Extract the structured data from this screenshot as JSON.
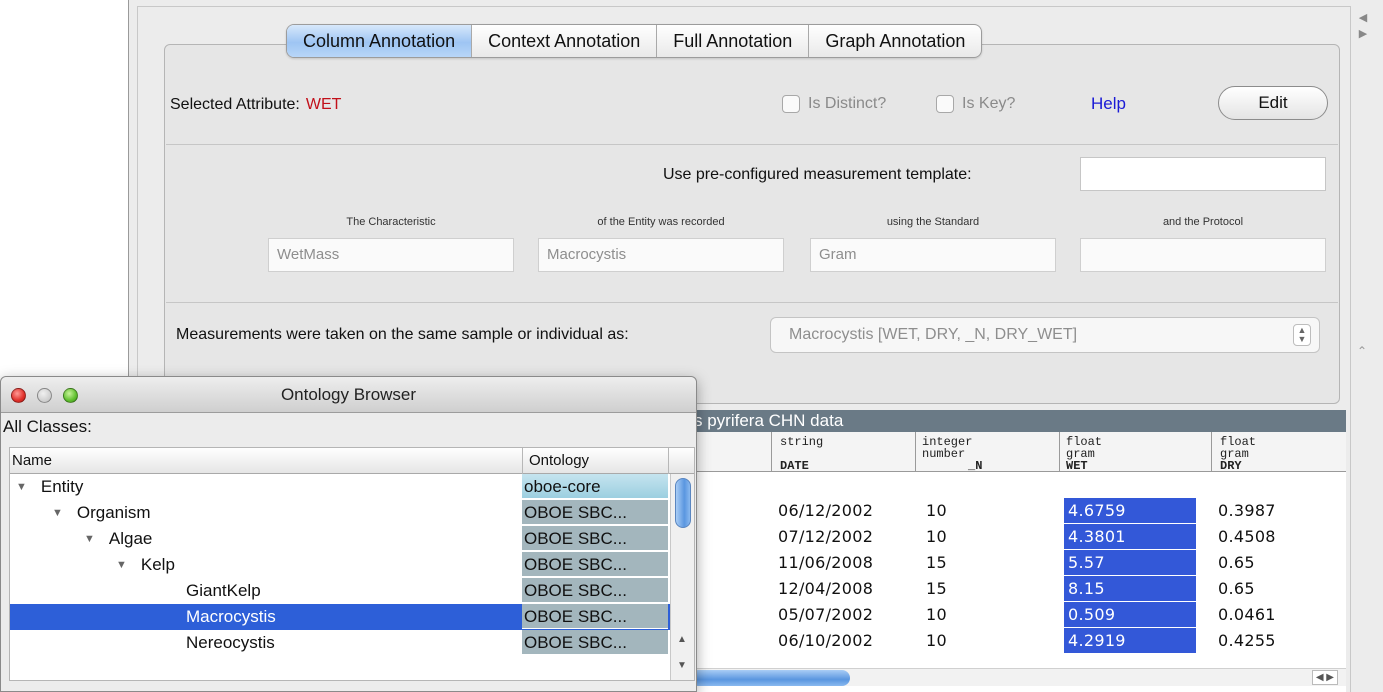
{
  "tabs": [
    "Column Annotation",
    "Context Annotation",
    "Full Annotation",
    "Graph Annotation"
  ],
  "active_tab": 0,
  "attribute": {
    "label": "Selected Attribute:",
    "value": "WET",
    "is_distinct_label": "Is Distinct?",
    "is_key_label": "Is Key?",
    "help_label": "Help",
    "edit_label": "Edit"
  },
  "template": {
    "label": "Use pre-configured measurement template:",
    "value": ""
  },
  "columns": [
    {
      "caption": "The Characteristic",
      "value": "WetMass"
    },
    {
      "caption": "of the Entity was recorded",
      "value": "Macrocystis"
    },
    {
      "caption": "using the Standard",
      "value": "Gram"
    },
    {
      "caption": "and the Protocol",
      "value": ""
    }
  ],
  "measurements": {
    "label": "Measurements were taken on the same sample or individual as:",
    "selected": "Macrocystis [WET, DRY, _N, DRY_WET]"
  },
  "data_table": {
    "title": "s pyrifera CHN data",
    "headers": [
      {
        "type": "",
        "unit": "",
        "name": ""
      },
      {
        "type": "string",
        "unit": "",
        "name": "DATE"
      },
      {
        "type": "integer",
        "unit": "number",
        "name": "_N"
      },
      {
        "type": "float",
        "unit": "gram",
        "name": "WET"
      },
      {
        "type": "float",
        "unit": "gram",
        "name": "DRY"
      }
    ],
    "rows": [
      [
        "06/12/2002",
        "10",
        "4.6759",
        "0.3987"
      ],
      [
        "07/12/2002",
        "10",
        "4.3801",
        "0.4508"
      ],
      [
        "11/06/2008",
        "15",
        "5.57",
        "0.65"
      ],
      [
        "12/04/2008",
        "15",
        "8.15",
        "0.65"
      ],
      [
        "05/07/2002",
        "10",
        "0.509",
        "0.0461"
      ],
      [
        "06/10/2002",
        "10",
        "4.2919",
        "0.4255"
      ]
    ]
  },
  "ontology_browser": {
    "title": "Ontology Browser",
    "subtitle": "All Classes:",
    "col_name": "Name",
    "col_ontology": "Ontology",
    "rows": [
      {
        "name": "Entity",
        "level": 0,
        "expanded": true,
        "ontology": "oboe-core"
      },
      {
        "name": "Organism",
        "level": 1,
        "expanded": true,
        "ontology": "OBOE SBC..."
      },
      {
        "name": "Algae",
        "level": 2,
        "expanded": true,
        "ontology": "OBOE SBC..."
      },
      {
        "name": "Kelp",
        "level": 3,
        "expanded": true,
        "ontology": "OBOE SBC..."
      },
      {
        "name": "GiantKelp",
        "level": 4,
        "expanded": false,
        "ontology": "OBOE SBC..."
      },
      {
        "name": "Macrocystis",
        "level": 4,
        "expanded": false,
        "ontology": "OBOE SBC...",
        "selected": true
      },
      {
        "name": "Nereocystis",
        "level": 4,
        "expanded": false,
        "ontology": "OBOE SBC..."
      }
    ]
  },
  "icons": {
    "tree_expanded": "triangle-down-icon",
    "scroll_up": "arrow-up-icon",
    "scroll_down": "arrow-down-icon"
  },
  "colors": {
    "accent": "#3358d8",
    "attr_value": "#c2101a",
    "help_link": "#1a1ad6",
    "tab_active": "#9ec5f3"
  }
}
